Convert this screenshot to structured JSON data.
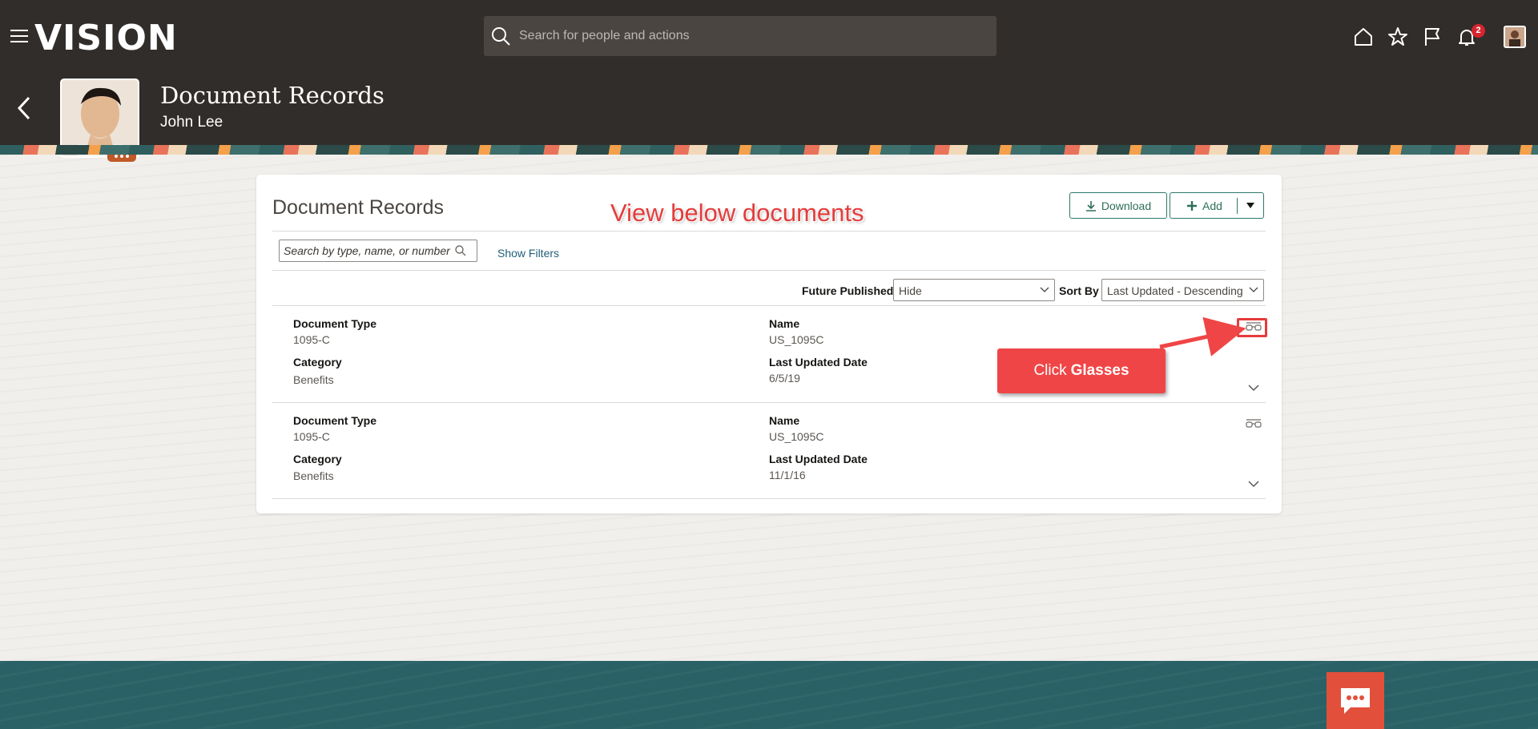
{
  "app": {
    "logo": "VISION"
  },
  "header": {
    "search_placeholder": "Search for people and actions",
    "notification_count": "2"
  },
  "profile": {
    "page_title": "Document Records",
    "person_name": "John Lee"
  },
  "card": {
    "title": "Document Records",
    "download_label": "Download",
    "add_label": "Add",
    "search_placeholder": "Search by type, name, or number",
    "show_filters_label": "Show Filters",
    "future_published_label": "Future Published",
    "future_published_value": "Hide",
    "sort_by_label": "Sort By",
    "sort_by_value": "Last Updated - Descending"
  },
  "records": [
    {
      "type_label": "Document Type",
      "type_value": "1095-C",
      "name_label": "Name",
      "name_value": "US_1095C",
      "category_label": "Category",
      "category_value": "Benefits",
      "updated_label": "Last Updated Date",
      "updated_value": "6/5/19"
    },
    {
      "type_label": "Document Type",
      "type_value": "1095-C",
      "name_label": "Name",
      "name_value": "US_1095C",
      "category_label": "Category",
      "category_value": "Benefits",
      "updated_label": "Last Updated Date",
      "updated_value": "11/1/16"
    }
  ],
  "annotations": {
    "view_text": "View below documents",
    "click_text": "Click",
    "click_bold": "Glasses"
  },
  "colors": {
    "header_bg": "#312d2a",
    "accent_green": "#2d6e5b",
    "annotation_red": "#f04546",
    "footer_teal": "#2a6166",
    "chat_orange": "#e2503b"
  }
}
